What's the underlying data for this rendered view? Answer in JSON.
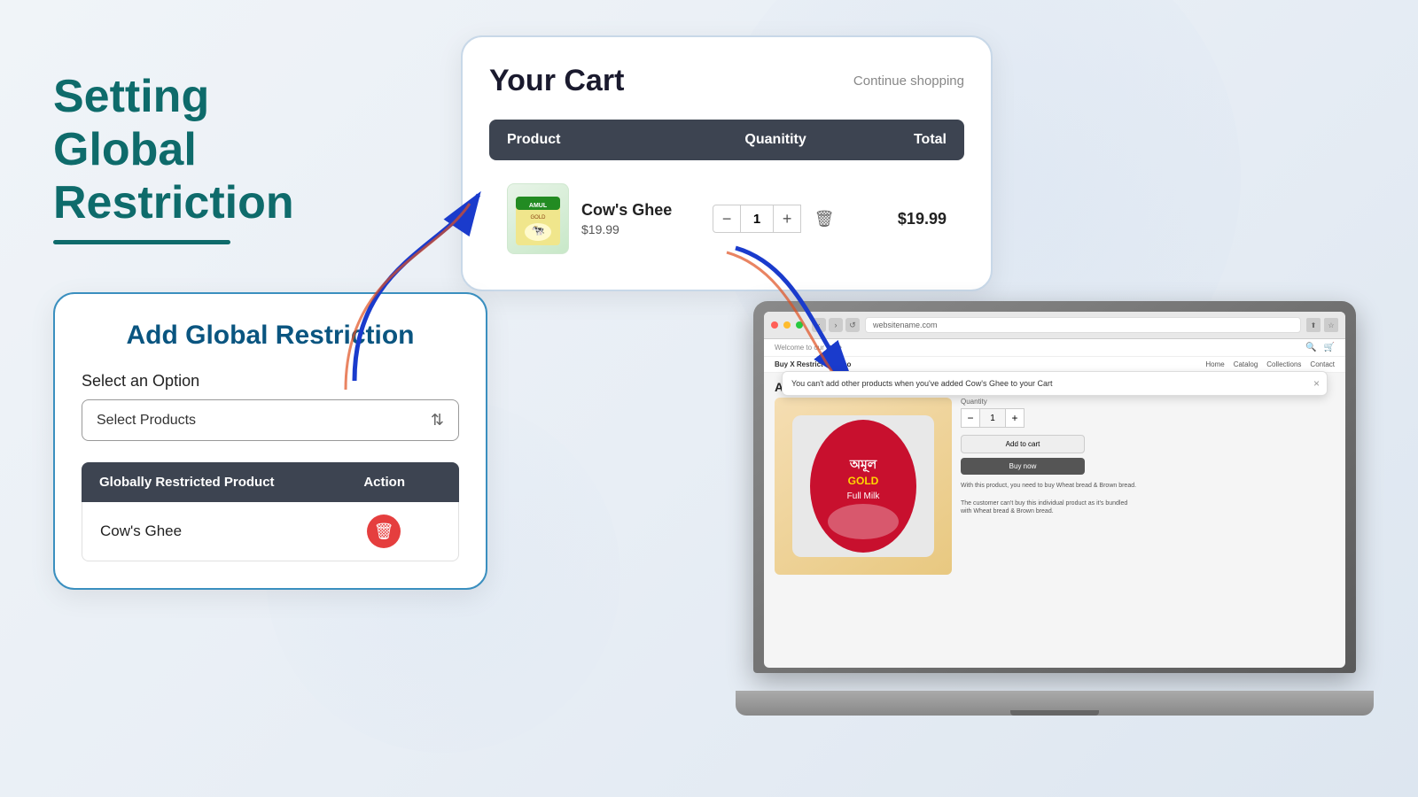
{
  "page": {
    "background": "#f0f4f8"
  },
  "title": {
    "line1": "Setting Global",
    "line2": "Restriction"
  },
  "cart": {
    "title": "Your Cart",
    "continue_shopping": "Continue shopping",
    "columns": {
      "product": "Product",
      "quantity": "Quanitity",
      "total": "Total"
    },
    "items": [
      {
        "name": "Cow's Ghee",
        "price": "$19.99",
        "quantity": 1,
        "total": "$19.99",
        "emoji": "🐄"
      }
    ]
  },
  "restriction_card": {
    "title": "Add Global Restriction",
    "select_label": "Select an Option",
    "select_placeholder": "Select Products",
    "table_headers": {
      "product": "Globally Restricted Product",
      "action": "Action"
    },
    "restricted_products": [
      {
        "name": "Cow's Ghee"
      }
    ]
  },
  "laptop": {
    "url": "websitename.com",
    "nav_title": "Buy X Restrict Y Demo",
    "nav_links": [
      "Home",
      "Catalog",
      "Collections",
      "Contact"
    ],
    "header_text": "Welcome to our store",
    "product_title": "Amul milk",
    "notification_text": "You can't add other products when you've added Cow's Ghee to your Cart",
    "qty_label": "Quantity",
    "qty_value": "1",
    "add_to_cart": "Add to cart",
    "buy_now": "Buy now",
    "description_line1": "With this product, you need to buy Wheat bread & Brown bread.",
    "description_line2": "The customer can't buy this individual product as it's bundled with Wheat bread & Brown bread."
  },
  "icons": {
    "chevron": "⇅",
    "trash": "🗑",
    "close": "×",
    "back": "‹",
    "forward": "›",
    "reload": "↺",
    "search": "🔍",
    "cart_icon": "🛒"
  }
}
